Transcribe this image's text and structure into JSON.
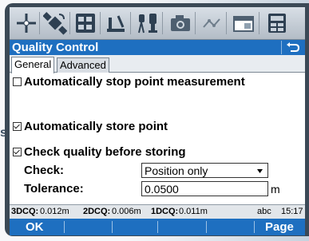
{
  "background": {
    "visible_text": "s"
  },
  "toolbar": {
    "icons": [
      "crosshair-icon",
      "satellite-icon",
      "keypad-icon",
      "level-icon",
      "tripod-icon",
      "camera-icon",
      "map-icon",
      "window-icon",
      "calculator-icon"
    ]
  },
  "title": {
    "text": "Quality Control",
    "back_icon": "return-icon"
  },
  "tabs": [
    {
      "label": "General",
      "active": true
    },
    {
      "label": "Advanced",
      "active": false
    }
  ],
  "general": {
    "auto_stop": {
      "label": "Automatically stop point measurement",
      "checked": false
    },
    "auto_store": {
      "label": "Automatically store point",
      "checked": true
    },
    "check_quality": {
      "label": "Check quality before storing",
      "checked": true
    },
    "check_label": "Check:",
    "check_value": "Position only",
    "tolerance_label": "Tolerance:",
    "tolerance_value": "0.0500",
    "tolerance_unit": "m"
  },
  "status": {
    "dcq3_label": "3DCQ:",
    "dcq3_value": "0.012m",
    "dcq2_label": "2DCQ:",
    "dcq2_value": "0.006m",
    "dcq1_label": "1DCQ:",
    "dcq1_value": "0.011m",
    "input_mode": "abc",
    "time": "15:17"
  },
  "softkeys": {
    "left": "OK",
    "right": "Page"
  },
  "colors": {
    "titlebar": "#1e6fc0",
    "frame": "#3b4956"
  }
}
